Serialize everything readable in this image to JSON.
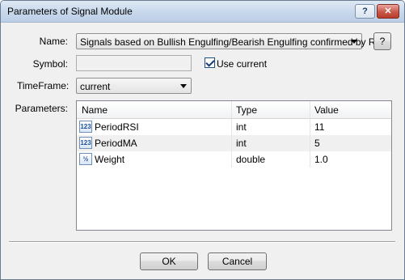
{
  "window": {
    "title": "Parameters of Signal Module"
  },
  "titlebar": {
    "help_label": "?",
    "close_label": "✕"
  },
  "form": {
    "name_label": "Name:",
    "name_value": "Signals based on Bullish Engulfing/Bearish Engulfing confirmed by RSI",
    "name_help_label": "?",
    "symbol_label": "Symbol:",
    "symbol_value": "",
    "use_current_label": "Use current",
    "use_current_checked": true,
    "timeframe_label": "TimeFrame:",
    "timeframe_value": "current",
    "parameters_label": "Parameters:"
  },
  "parameters": {
    "columns": [
      "Name",
      "Type",
      "Value"
    ],
    "rows": [
      {
        "icon": "integer-param-icon",
        "icon_text": "123",
        "name": "PeriodRSI",
        "type": "int",
        "value": "11"
      },
      {
        "icon": "integer-param-icon",
        "icon_text": "123",
        "name": "PeriodMA",
        "type": "int",
        "value": "5"
      },
      {
        "icon": "double-param-icon",
        "icon_text": "½",
        "name": "Weight",
        "type": "double",
        "value": "1.0"
      }
    ]
  },
  "buttons": {
    "ok_label": "OK",
    "cancel_label": "Cancel"
  }
}
